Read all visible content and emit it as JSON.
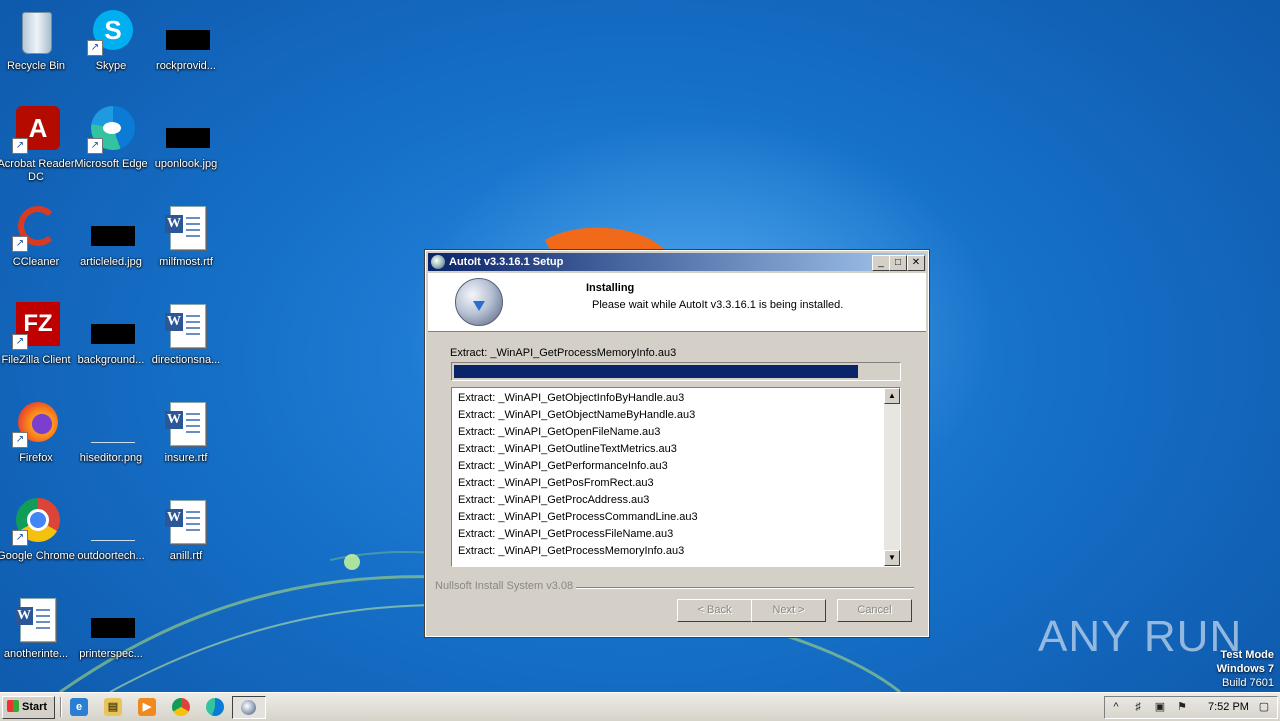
{
  "desktop": {
    "icons": [
      {
        "label": "Recycle Bin"
      },
      {
        "label": "Skype"
      },
      {
        "label": "rockprovid..."
      },
      {
        "label": "Acrobat Reader DC"
      },
      {
        "label": "Microsoft Edge"
      },
      {
        "label": "uponlook.jpg"
      },
      {
        "label": "CCleaner"
      },
      {
        "label": "articleled.jpg"
      },
      {
        "label": "milfmost.rtf"
      },
      {
        "label": "FileZilla Client"
      },
      {
        "label": "background..."
      },
      {
        "label": "directionsna..."
      },
      {
        "label": "Firefox"
      },
      {
        "label": "hiseditor.png"
      },
      {
        "label": "insure.rtf"
      },
      {
        "label": "Google Chrome"
      },
      {
        "label": "outdoortech..."
      },
      {
        "label": "anill.rtf"
      },
      {
        "label": "anotherinte..."
      },
      {
        "label": "printerspec..."
      }
    ]
  },
  "installer": {
    "title": "AutoIt v3.3.16.1 Setup",
    "header_title": "Installing",
    "header_subtitle": "Please wait while AutoIt v3.3.16.1 is being installed.",
    "status": "Extract: _WinAPI_GetProcessMemoryInfo.au3",
    "progress": 0.91,
    "details": [
      "Extract: _WinAPI_GetObjectInfoByHandle.au3",
      "Extract: _WinAPI_GetObjectNameByHandle.au3",
      "Extract: _WinAPI_GetOpenFileName.au3",
      "Extract: _WinAPI_GetOutlineTextMetrics.au3",
      "Extract: _WinAPI_GetPerformanceInfo.au3",
      "Extract: _WinAPI_GetPosFromRect.au3",
      "Extract: _WinAPI_GetProcAddress.au3",
      "Extract: _WinAPI_GetProcessCommandLine.au3",
      "Extract: _WinAPI_GetProcessFileName.au3",
      "Extract: _WinAPI_GetProcessMemoryInfo.au3"
    ],
    "branding": "Nullsoft Install System v3.08",
    "buttons": {
      "back": "< Back",
      "next": "Next >",
      "cancel": "Cancel"
    }
  },
  "watermark": {
    "text": "ANY RUN"
  },
  "test_mode": {
    "line1": "Test Mode",
    "line2": "Windows 7",
    "line3": "Build 7601"
  },
  "taskbar": {
    "start_label": "Start",
    "clock": "7:52 PM",
    "tray_show_hidden": "^"
  }
}
